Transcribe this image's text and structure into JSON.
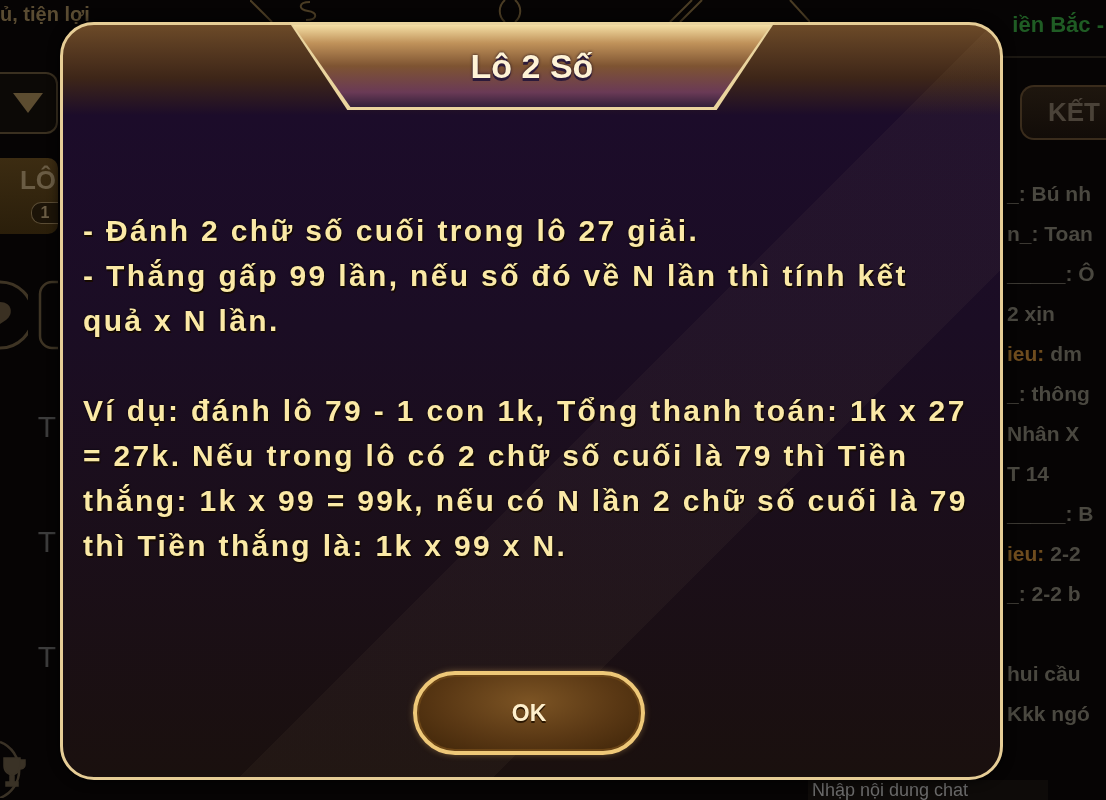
{
  "background": {
    "tagline": "ủ, tiện lợi",
    "region_label": "iền Bắc -",
    "left_panel": {
      "tabs": [
        {
          "label": "LÔ",
          "badge": "1",
          "selected": true
        }
      ],
      "row_labels": [
        "T",
        "T",
        "T"
      ]
    },
    "right_panel": {
      "result_button": "KẾT",
      "chat_messages": [
        {
          "message": "_: Bú nh"
        },
        {
          "message": "n_: Toan"
        },
        {
          "message": "_____: Ô"
        },
        {
          "message": "2 xịn"
        },
        {
          "sender": "ieu:",
          "message": "dm",
          "color": "#6e4c1e"
        },
        {
          "message": "_: thông"
        },
        {
          "message": "Nhân X"
        },
        {
          "message": "T 14"
        },
        {
          "message": "_____: B"
        },
        {
          "sender": "ieu:",
          "message": "2-2",
          "color": "#6e4c1e"
        },
        {
          "message": "_: 2-2 b"
        },
        {
          "message": "hui cầu"
        },
        {
          "message": "Kkk ngó"
        }
      ],
      "chat_input": {
        "placeholder": "Nhập nội dung chat"
      }
    }
  },
  "dialog": {
    "title": "Lô 2 Số",
    "rules": [
      "- Đánh 2 chữ số cuối trong lô 27 giải.",
      "- Thắng gấp 99 lần, nếu số đó về N lần thì tính kết quả x N lần."
    ],
    "example": "Ví dụ: đánh lô 79 - 1 con 1k, Tổng thanh toán: 1k x 27 = 27k. Nếu trong lô có 2 chữ số cuối là 79 thì Tiền thắng: 1k x 99 = 99k, nếu có N lần 2 chữ số cuối là 79 thì Tiền thắng là: 1k x 99 x N.",
    "buttons": [
      "OK"
    ]
  }
}
